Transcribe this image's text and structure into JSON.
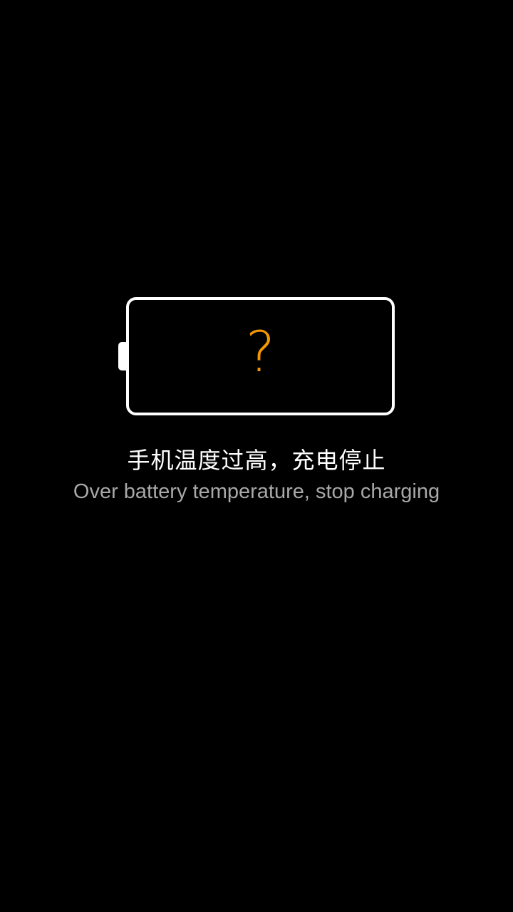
{
  "colors": {
    "background": "#000000",
    "battery_outline": "#ffffff",
    "warning_accent": "#f39800",
    "primary_text": "#ffffff",
    "secondary_text": "#a8a8a8"
  },
  "battery": {
    "icon": "battery-unknown-icon",
    "status_glyph": "?"
  },
  "message": {
    "chinese": "手机温度过高，充电停止",
    "english": "Over battery temperature, stop charging"
  }
}
